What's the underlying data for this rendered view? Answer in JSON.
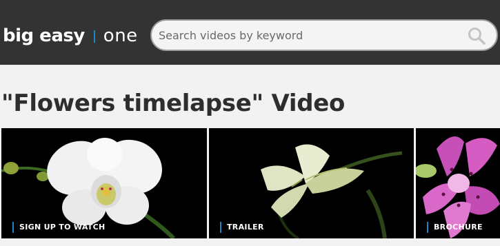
{
  "header": {
    "logo_main": "big easy",
    "logo_sub": "one",
    "search_placeholder": "Search videos by keyword"
  },
  "main": {
    "title": "\"Flowers timelapse\" Video"
  },
  "cards": [
    {
      "label": "SIGN UP TO WATCH"
    },
    {
      "label": "TRAILER"
    },
    {
      "label": "BROCHURE"
    }
  ],
  "colors": {
    "header_bg": "#333333",
    "accent": "#1e88c7"
  }
}
